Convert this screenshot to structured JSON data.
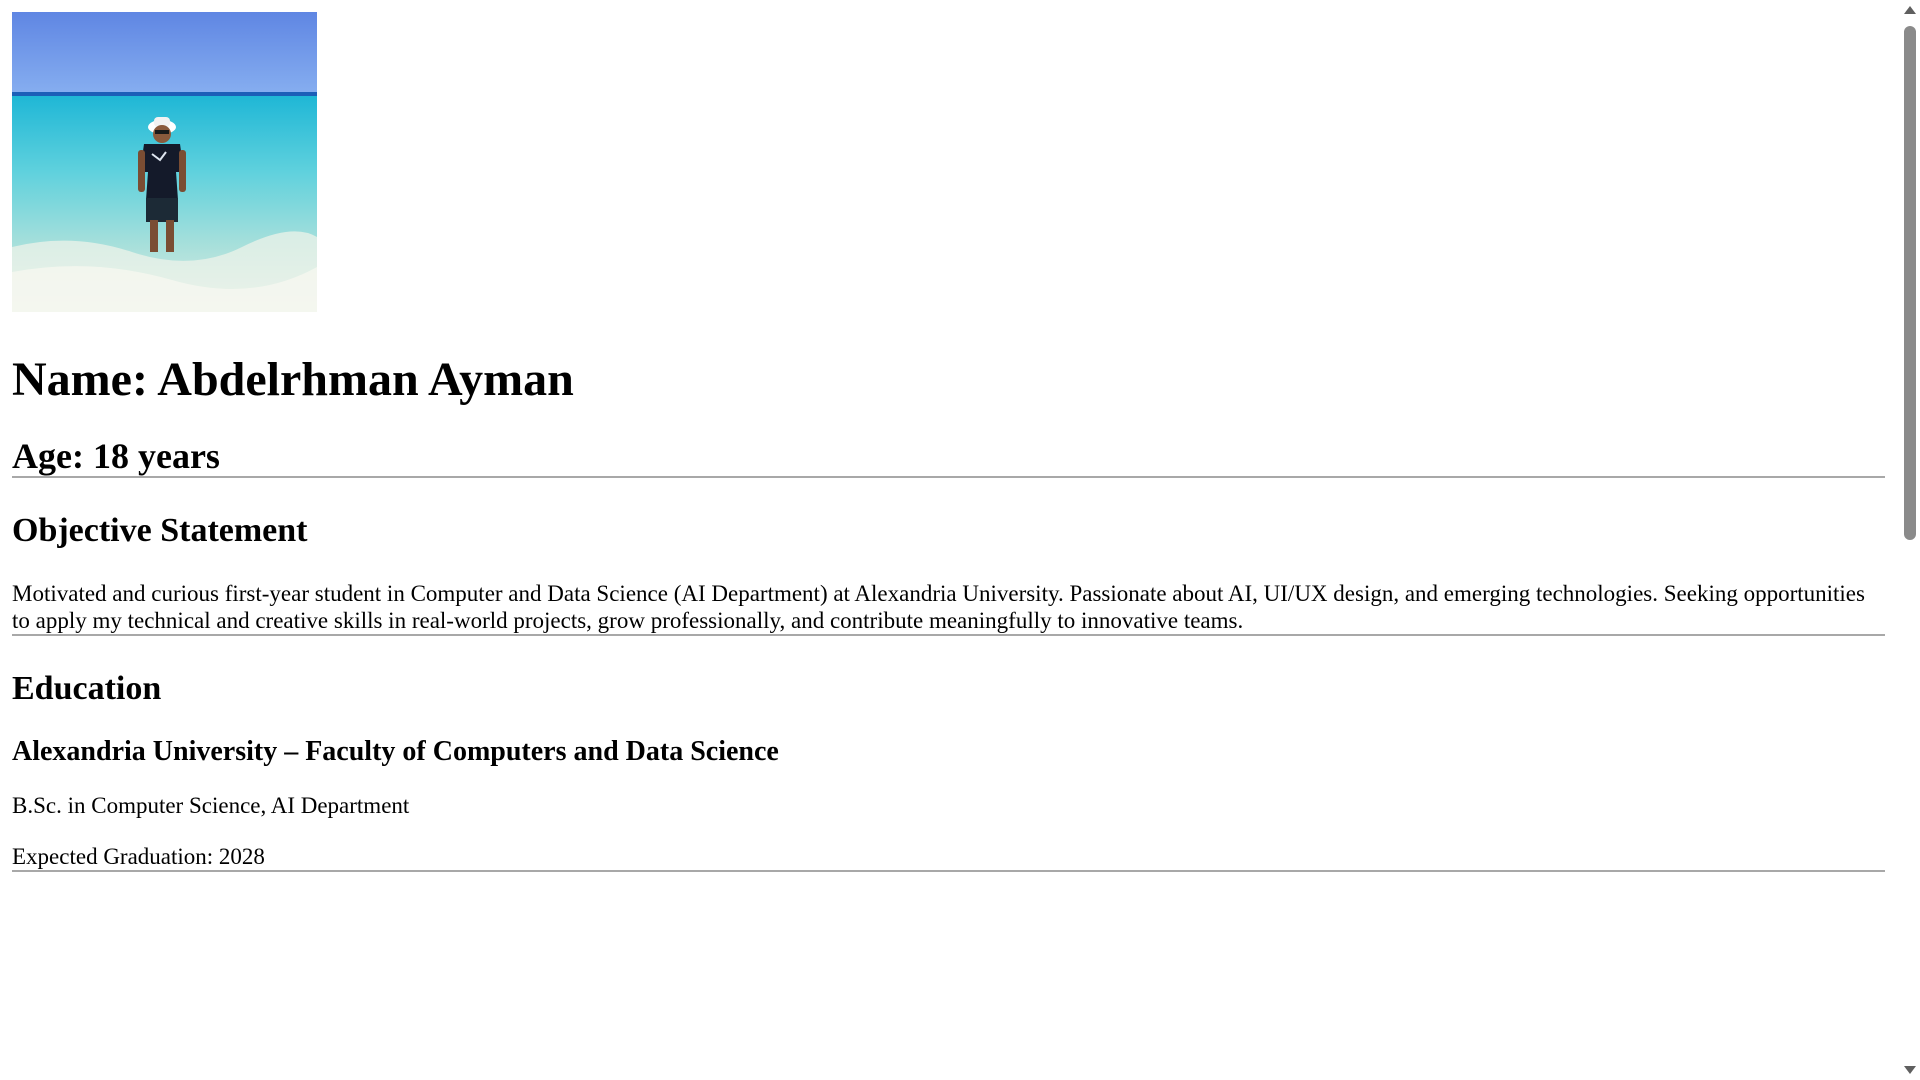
{
  "profile": {
    "photo_alt": "Person standing in shallow turquoise sea water",
    "name": "Name: Abdelrhman Ayman",
    "age": "Age: 18 years"
  },
  "objective": {
    "heading": "Objective Statement",
    "text": "Motivated and curious first-year student in Computer and Data Science (AI Department) at Alexandria University. Passionate about AI, UI/UX design, and emerging technologies. Seeking opportunities to apply my technical and creative skills in real-world projects, grow professionally, and contribute meaningfully to innovative teams."
  },
  "education": {
    "heading": "Education",
    "school": "Alexandria University – Faculty of Computers and Data Science",
    "degree": "B.Sc. in Computer Science, AI Department",
    "graduation": "Expected Graduation: 2028"
  },
  "scrollbar": {
    "up_icon": "arrow-up-icon",
    "down_icon": "arrow-down-icon"
  }
}
